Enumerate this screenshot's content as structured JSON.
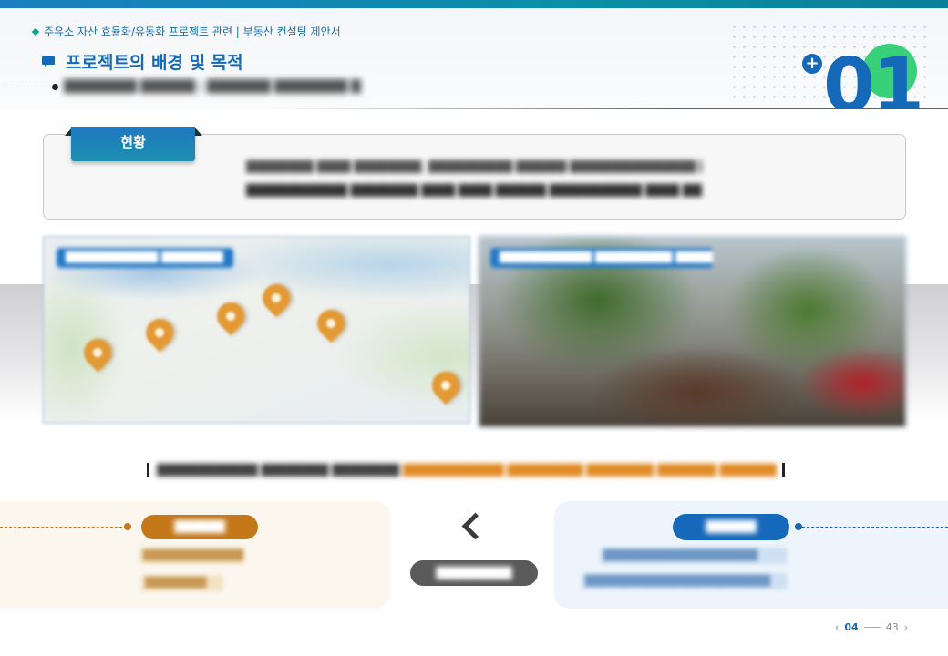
{
  "header": {
    "breadcrumb": "주유소 자산 효율화/유동화 프로젝트 관련 | 부동산 컨설팅 제안서",
    "title": "프로젝트의 배경 및 목적",
    "subtitle": "████████ ██████ | ███████ ████████ ████ ███████",
    "chapter_number": "01",
    "plus_symbol": "+"
  },
  "status": {
    "tab_label": "현황",
    "line1": "████████ ████ ████████, ██████████ ██████ ███████████████ ████████████ █████",
    "line2": "████████████ ████████ ████ ████ ██████ ███████████ ████ ███████ ████████ ████"
  },
  "photos": {
    "map_caption": "████████████ ████████",
    "street_caption": "████████████ ██████████ ████████",
    "pin_icon": "map-pin-icon"
  },
  "summary": {
    "part1": "████████████ ████████ ████████",
    "part2": "████████████ █████████ ████████ ███████ ██████████ ████████ ████"
  },
  "compare": {
    "left_pill": "██████",
    "left_line1": "█████████████",
    "left_line2": "████████",
    "middle_pill": "█████████",
    "right_pill": "██████",
    "right_line1": "████████████████████",
    "right_line2": "████████████████████████"
  },
  "pager": {
    "current": "04",
    "total": "43",
    "prev_symbol": "‹",
    "next_symbol": "›"
  },
  "colors": {
    "primary_blue": "#1469b8",
    "teal": "#0ba19a",
    "green_accent": "#39d07a",
    "orange_accent": "#c4781a",
    "pin_orange": "#e39a35"
  }
}
